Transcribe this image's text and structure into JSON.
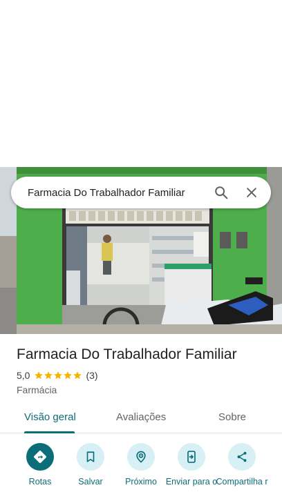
{
  "search": {
    "query": "Farmacia Do Trabalhador Familiar"
  },
  "place": {
    "name": "Farmacia Do Trabalhador Familiar",
    "rating": "5,0",
    "stars": 5,
    "review_count": "(3)",
    "category": "Farmácia"
  },
  "tabs": [
    {
      "label": "Visão geral",
      "active": true
    },
    {
      "label": "Avaliações",
      "active": false
    },
    {
      "label": "Sobre",
      "active": false
    }
  ],
  "actions": [
    {
      "label": "Rotas",
      "icon": "directions-icon"
    },
    {
      "label": "Salvar",
      "icon": "bookmark-icon"
    },
    {
      "label": "Próximo",
      "icon": "nearby-icon"
    },
    {
      "label": "Enviar para o",
      "icon": "send-to-phone-icon"
    },
    {
      "label": "Compartilha r",
      "icon": "share-icon"
    }
  ],
  "colors": {
    "accent": "#0b6d78",
    "accent_light": "#d6f0f5",
    "star": "#f4b400",
    "storefront_green": "#4caf50"
  }
}
